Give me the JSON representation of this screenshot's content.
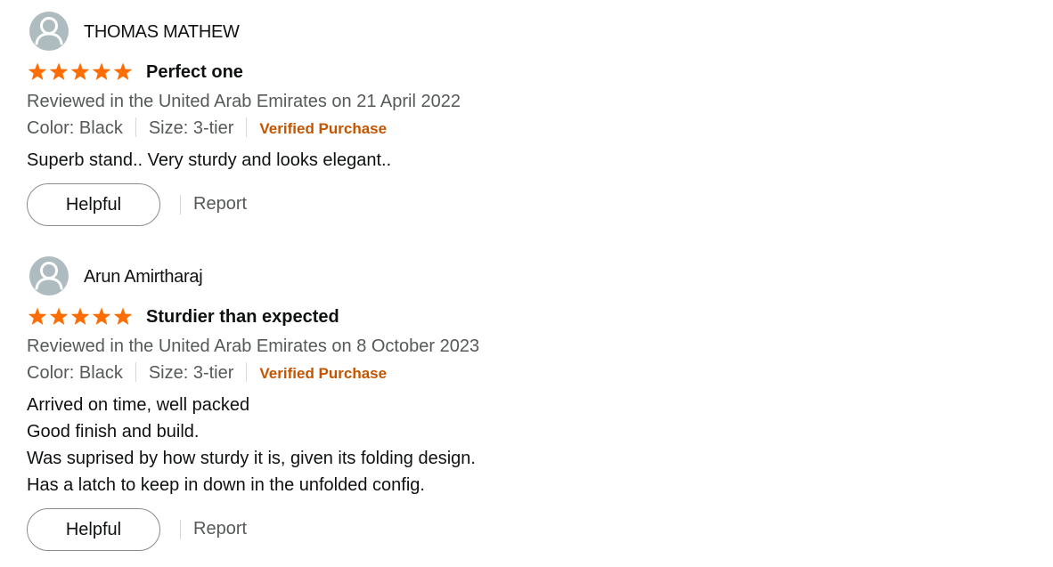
{
  "colors": {
    "star": "#ff6c02",
    "verified": "#c45500",
    "muted": "#565959",
    "avatar_bg": "#aebcc0"
  },
  "reviews": [
    {
      "reviewer_name": "THOMAS MATHEW",
      "avatar_icon": "user-avatar-icon",
      "rating": 5,
      "title": "Perfect one",
      "date_line": "Reviewed in the United Arab Emirates on 21 April 2022",
      "color": "Color: Black",
      "size": "Size: 3-tier",
      "verified": "Verified Purchase",
      "body_lines": [
        "Superb stand.. Very sturdy and looks elegant.."
      ],
      "helpful_label": "Helpful",
      "report_label": "Report"
    },
    {
      "reviewer_name": "Arun Amirtharaj",
      "avatar_icon": "user-avatar-icon",
      "rating": 5,
      "title": "Sturdier than expected",
      "date_line": "Reviewed in the United Arab Emirates on 8 October 2023",
      "color": "Color: Black",
      "size": "Size: 3-tier",
      "verified": "Verified Purchase",
      "body_lines": [
        "Arrived on time, well packed",
        "Good finish and build.",
        "Was suprised by how sturdy it is, given its folding design.",
        "Has a latch to keep in down in the unfolded config."
      ],
      "helpful_label": "Helpful",
      "report_label": "Report"
    }
  ]
}
